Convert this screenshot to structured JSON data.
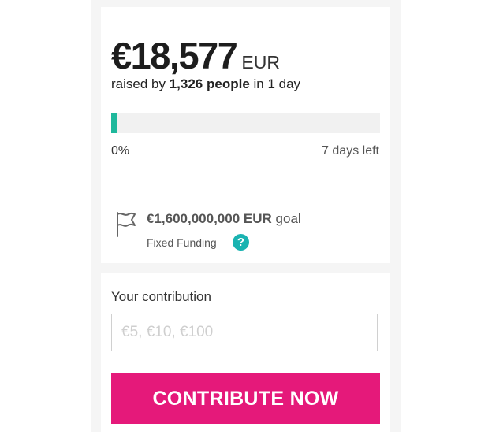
{
  "campaign": {
    "amount_raised": "€18,577",
    "currency": "EUR",
    "raised_prefix": "raised by",
    "backers": "1,326 people",
    "raised_suffix": "in 1 day",
    "progress_percent": 0,
    "progress_fill_fraction": 0.02,
    "progress_label": "0%",
    "time_left": "7 days left",
    "goal_amount": "€1,600,000,000",
    "goal_currency": "EUR",
    "goal_suffix": "goal",
    "funding_type": "Fixed Funding",
    "help_glyph": "?"
  },
  "contribution": {
    "label": "Your contribution",
    "value": "",
    "placeholder": "€5, €10, €100",
    "button_label": "CONTRIBUTE NOW"
  },
  "colors": {
    "progress": "#1fb89c",
    "help_icon": "#1ab3b1",
    "cta": "#e5197a"
  },
  "icons": {
    "goal": "flag-icon",
    "help": "question-icon"
  }
}
